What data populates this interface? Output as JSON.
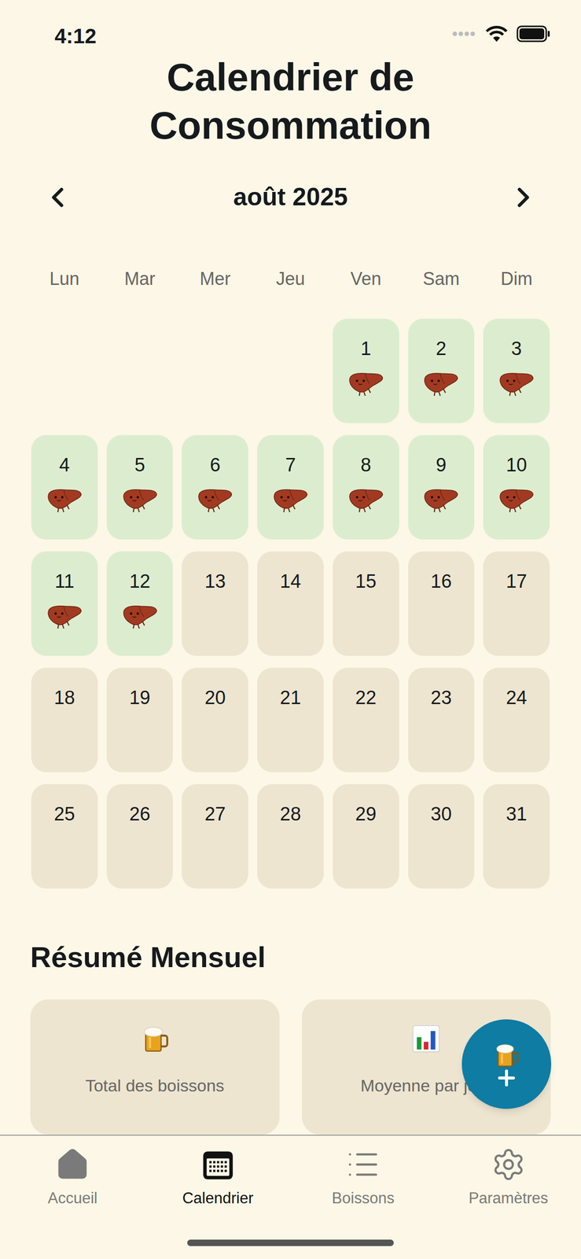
{
  "status_bar": {
    "time": "4:12"
  },
  "title": "Calendrier de Consommation",
  "month": {
    "label": "août 2025"
  },
  "weekdays": [
    "Lun",
    "Mar",
    "Mer",
    "Jeu",
    "Ven",
    "Sam",
    "Dim"
  ],
  "days": [
    {
      "label": "1",
      "logged": true
    },
    {
      "label": "2",
      "logged": true
    },
    {
      "label": "3",
      "logged": true
    },
    {
      "label": "4",
      "logged": true
    },
    {
      "label": "5",
      "logged": true
    },
    {
      "label": "6",
      "logged": true
    },
    {
      "label": "7",
      "logged": true
    },
    {
      "label": "8",
      "logged": true
    },
    {
      "label": "9",
      "logged": true
    },
    {
      "label": "10",
      "logged": true
    },
    {
      "label": "11",
      "logged": true
    },
    {
      "label": "12",
      "logged": true
    },
    {
      "label": "13",
      "logged": false
    },
    {
      "label": "14",
      "logged": false
    },
    {
      "label": "15",
      "logged": false
    },
    {
      "label": "16",
      "logged": false
    },
    {
      "label": "17",
      "logged": false
    },
    {
      "label": "18",
      "logged": false
    },
    {
      "label": "19",
      "logged": false
    },
    {
      "label": "20",
      "logged": false
    },
    {
      "label": "21",
      "logged": false
    },
    {
      "label": "22",
      "logged": false
    },
    {
      "label": "23",
      "logged": false
    },
    {
      "label": "24",
      "logged": false
    },
    {
      "label": "25",
      "logged": false
    },
    {
      "label": "26",
      "logged": false
    },
    {
      "label": "27",
      "logged": false
    },
    {
      "label": "28",
      "logged": false
    },
    {
      "label": "29",
      "logged": false
    },
    {
      "label": "30",
      "logged": false
    },
    {
      "label": "31",
      "logged": false
    }
  ],
  "summary": {
    "title": "Résumé Mensuel",
    "cards": [
      {
        "kind": "total",
        "label": "Total des boissons"
      },
      {
        "kind": "average",
        "label": "Moyenne par jour"
      }
    ]
  },
  "tab_bar": [
    {
      "label": "Accueil",
      "selected": false
    },
    {
      "label": "Calendrier",
      "selected": true
    },
    {
      "label": "Boissons",
      "selected": false
    },
    {
      "label": "Paramètres",
      "selected": false
    }
  ]
}
